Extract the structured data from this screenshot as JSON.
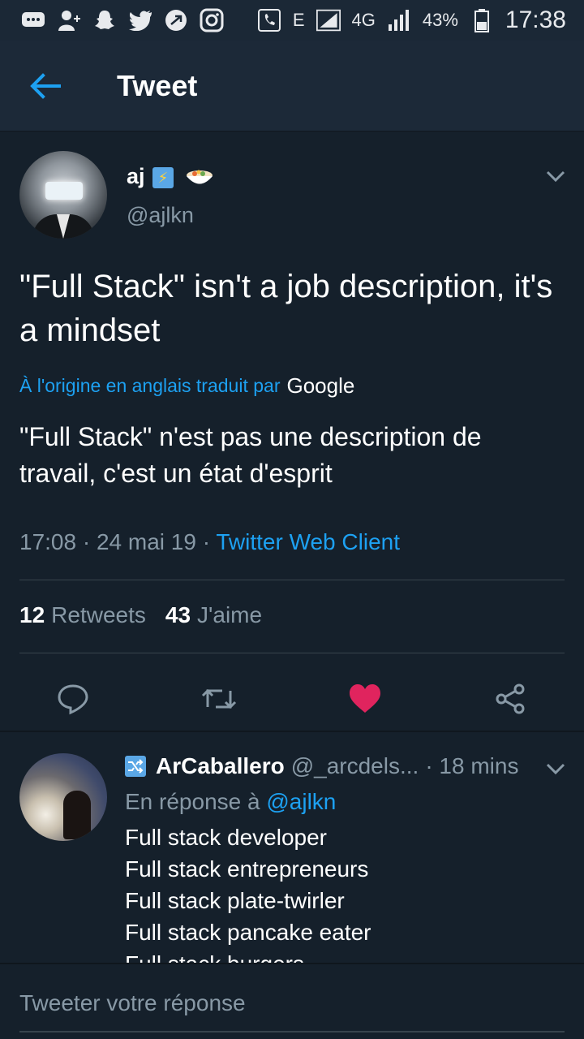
{
  "status_bar": {
    "network_type": "E",
    "network_4g": "4G",
    "battery_percent": "43%",
    "time": "17:38",
    "icons": [
      "messages-icon",
      "add-contact-icon",
      "snapchat-icon",
      "twitter-icon",
      "nfc-icon",
      "instagram-icon",
      "phone-icon",
      "signal-icon",
      "battery-icon"
    ]
  },
  "header": {
    "title": "Tweet"
  },
  "tweet": {
    "author_name": "aj",
    "author_badge": "⚡",
    "author_handle": "@ajlkn",
    "text": "\"Full Stack\" isn't a job description, it's a mindset",
    "translated_by": "À l'origine en anglais traduit par",
    "translator": "Google",
    "translated_text": "\"Full Stack\" n'est pas une description de travail, c'est un état d'esprit",
    "time": "17:08",
    "date": "24 mai 19",
    "separator": "·",
    "client": "Twitter Web Client",
    "retweets_count": "12",
    "retweets_label": "Retweets",
    "likes_count": "43",
    "likes_label": "J'aime",
    "liked": true,
    "like_color": "#e0245e"
  },
  "reply": {
    "name": "ArCaballero",
    "handle": "@_arcdels...",
    "time": "· 18 mins",
    "in_reply_to_label": "En réponse à",
    "in_reply_to_handle": "@ajlkn",
    "lines": [
      "Full stack developer",
      "Full stack entrepreneurs",
      "Full stack plate-twirler",
      "Full stack pancake eater",
      "Full stack burgers"
    ]
  },
  "compose": {
    "placeholder": "Tweeter votre réponse"
  },
  "colors": {
    "background": "#15202b",
    "accent": "#1da1f2",
    "secondary_text": "#8899a6"
  }
}
